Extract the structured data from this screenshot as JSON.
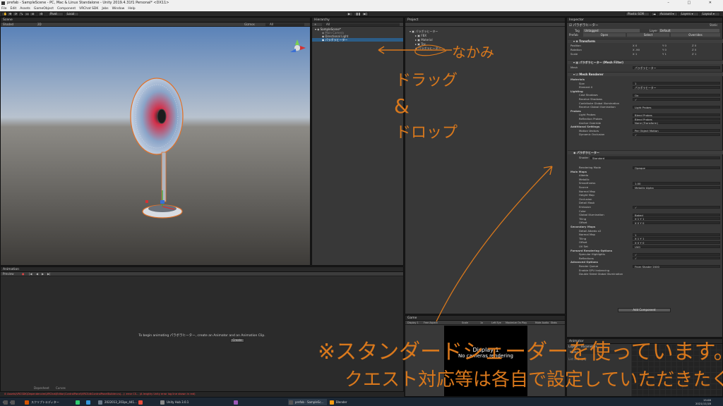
{
  "window": {
    "title": "prefab - SampleScene - PC, Mac & Linux Standalone - Unity 2019.4.31f1 Personal* <DX11>",
    "controls": [
      "–",
      "□",
      "✕"
    ]
  },
  "menu": [
    "File",
    "Edit",
    "Assets",
    "GameObject",
    "Component",
    "VRChat SDK",
    "Jobs",
    "Window",
    "Help"
  ],
  "toolbar": {
    "pivot": "Pivot",
    "local": "Local",
    "collab": "Plastic SCM",
    "account": "Account",
    "layers": "Layers",
    "layout": "Layout"
  },
  "scene": {
    "tab": "Scene",
    "shading": "Shaded",
    "mode": "2D",
    "gizmos": "Gizmos",
    "search": "All"
  },
  "hierarchy": {
    "tab": "Hierarchy",
    "create": "+",
    "search": "All",
    "root": "SampleScene*",
    "items": [
      "Main Camera",
      "Directional Light",
      "パラボラヒーター"
    ]
  },
  "project": {
    "tab": "Project",
    "items": [
      "パラボラヒーター",
      "FBX",
      "Material",
      "Tex",
      "パラボラヒーター"
    ]
  },
  "inspector": {
    "tab": "Inspector",
    "object_name": "パラボラヒーター",
    "static": "Static",
    "tag_label": "Tag",
    "tag": "Untagged",
    "layer_label": "Layer",
    "layer": "Default",
    "prefab_label": "Prefab",
    "prefab_open": "Open",
    "prefab_select": "Select",
    "prefab_overrides": "Overrides",
    "transform": {
      "title": "Transform",
      "position_label": "Position",
      "rotation_label": "Rotation",
      "scale_label": "Scale",
      "position": [
        "0",
        "0",
        "0"
      ],
      "rotation": [
        "-90",
        "0",
        "0"
      ],
      "scale": [
        "1",
        "1",
        "1"
      ]
    },
    "mesh_filter": {
      "title": "パラボラヒーター (Mesh Filter)",
      "mesh_label": "Mesh",
      "mesh": "パラボラヒーター"
    },
    "mesh_renderer": {
      "title": "Mesh Renderer",
      "rows": [
        [
          "Materials",
          ""
        ],
        [
          "Size",
          "1"
        ],
        [
          "Element 0",
          "パラボラヒーター"
        ],
        [
          "Lighting",
          ""
        ],
        [
          "Cast Shadows",
          "On"
        ],
        [
          "Receive Shadows",
          "✓"
        ],
        [
          "Contribute Global Illumination",
          ""
        ],
        [
          "Receive Global Illumination",
          "Light Probes"
        ],
        [
          "Probes",
          ""
        ],
        [
          "Light Probes",
          "Blend Probes"
        ],
        [
          "Reflection Probes",
          "Blend Probes"
        ],
        [
          "Anchor Override",
          "None (Transform)"
        ],
        [
          "Additional Settings",
          ""
        ],
        [
          "Motion Vectors",
          "Per Object Motion"
        ],
        [
          "Dynamic Occlusion",
          "✓"
        ]
      ]
    },
    "material": {
      "name": "パラボラヒーター",
      "shader_label": "Shader",
      "shader": "Standard",
      "rows": [
        [
          "Rendering Mode",
          "Opaque"
        ],
        [
          "Main Maps",
          ""
        ],
        [
          "Albedo",
          ""
        ],
        [
          "Metallic",
          ""
        ],
        [
          "Smoothness",
          "1.00"
        ],
        [
          "Source",
          "Metallic Alpha"
        ],
        [
          "Normal Map",
          ""
        ],
        [
          "Height Map",
          ""
        ],
        [
          "Occlusion",
          ""
        ],
        [
          "Detail Mask",
          ""
        ],
        [
          "Emission",
          "✓"
        ],
        [
          "Color",
          ""
        ],
        [
          "Global Illumination",
          "Baked"
        ],
        [
          "Tiling",
          "X 1      Y 1"
        ],
        [
          "Offset",
          "X 0      Y 0"
        ],
        [
          "Secondary Maps",
          ""
        ],
        [
          "Detail Albedo x2",
          ""
        ],
        [
          "Normal Map",
          "1"
        ],
        [
          "Tiling",
          "X 1      Y 1"
        ],
        [
          "Offset",
          "X 0      Y 0"
        ],
        [
          "UV Set",
          "UV0"
        ],
        [
          "Forward Rendering Options",
          ""
        ],
        [
          "Specular Highlights",
          "✓"
        ],
        [
          "Reflections",
          "✓"
        ],
        [
          "Advanced Options",
          ""
        ],
        [
          "Render Queue",
          "From Shader   2000"
        ],
        [
          "Enable GPU Instancing",
          ""
        ],
        [
          "Double Sided Global Illumination",
          ""
        ]
      ],
      "add_component": "Add Component"
    }
  },
  "animation": {
    "tab": "Animation",
    "preview": "Preview",
    "message": "To begin animating パラボラヒーター, create an Animator and an Animation Clip.",
    "create": "Create",
    "dopesheet": "Dopesheet",
    "curves": "Curves"
  },
  "game": {
    "tab": "Game",
    "display": "Display 1",
    "aspect": "Free Aspect",
    "scale": "Scale",
    "scale_value": "1x",
    "options": [
      "Left Eye",
      "Maximize On Play",
      "Mute Audio",
      "Stats",
      "Gizmos"
    ],
    "overlay_title": "Display 1",
    "overlay_msg": "No cameras rendering"
  },
  "animator": {
    "tab": "Animator",
    "layers": "Layers",
    "parameters": "Parameters",
    "search": "Name",
    "list_empty": "List is Empty"
  },
  "status_error": "Assets\\VRCSDK\\Dependencies\\VRChat\\Editor\\ControlPanel\\VRCSdkControlPanelBuilder.cs(...): error CS... (A lengthy Unity error log line shown in red)",
  "taskbar": {
    "items": [
      {
        "label": "スクリプトエディター",
        "color": "#d35400"
      },
      {
        "label": "",
        "color": "#2ecc71"
      },
      {
        "label": "",
        "color": "#3498db"
      },
      {
        "label": "2022013_203px_441...",
        "color": "#6c7a89"
      },
      {
        "label": "",
        "color": "#e74c3c"
      },
      {
        "label": "Unity Hub 3.0.1",
        "color": "#888888"
      },
      {
        "label": "",
        "color": "#9b59b6"
      },
      {
        "label": "prefab - SampleSc...",
        "color": "#555555"
      },
      {
        "label": "Blender",
        "color": "#f39c12"
      }
    ],
    "time": "15:08",
    "date": "2021/11/18"
  },
  "annotations": {
    "nakami": "なかみ",
    "drag1": "ドラッグ",
    "and": "&",
    "drop": "ドロップ",
    "note1": "※スタンダードシェーダーを使っています。",
    "note2": "クエスト対応等は各自で設定していただきたく候"
  },
  "colors": {
    "accent": "#2c5d87",
    "annotation": "#d9781c",
    "error": "#ff4d4d"
  }
}
